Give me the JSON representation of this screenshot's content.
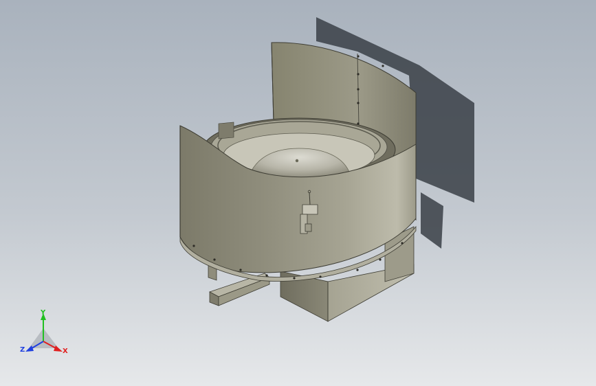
{
  "view": {
    "background_top": "#a9b2bd",
    "background_bottom": "#e6e8ea"
  },
  "model": {
    "component": "vibratory-feeder-bowl",
    "body_color": "#8d8b7a",
    "shadow_color": "#3a3f46"
  },
  "triad": {
    "x_label": "X",
    "y_label": "Y",
    "z_label": "Z",
    "x_color": "#e02020",
    "y_color": "#20c020",
    "z_color": "#2040e0"
  }
}
